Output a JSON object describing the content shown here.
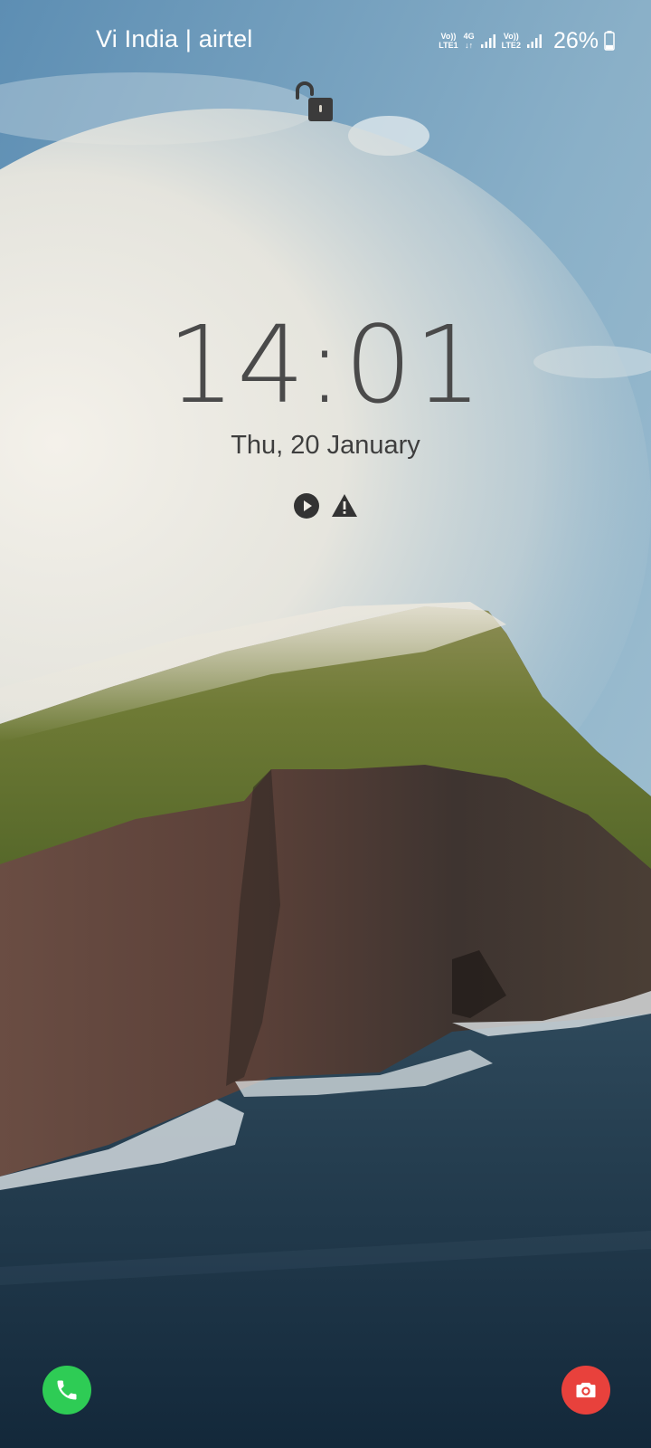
{
  "status_bar": {
    "carrier": "Vi India | airtel",
    "network": {
      "sim1": [
        "Vo))",
        "LTE1"
      ],
      "data": [
        "4G",
        "↓↑"
      ],
      "sim2": [
        "Vo))",
        "LTE2"
      ]
    },
    "battery_text": "26%",
    "battery_level": 0.26
  },
  "lockscreen": {
    "lock_icon": "unlocked-padlock-icon",
    "time": "14:01",
    "date": "Thu, 20 January",
    "notification_icons": [
      "play-circle-icon",
      "warning-triangle-icon"
    ]
  },
  "shortcuts": {
    "left": {
      "icon": "phone-icon",
      "color": "#2ecc55"
    },
    "right": {
      "icon": "camera-icon",
      "color": "#e8413c"
    }
  },
  "colors": {
    "clock_text": "#4a4a4a",
    "date_text": "#3e3e3e",
    "status_text": "#ffffff"
  }
}
